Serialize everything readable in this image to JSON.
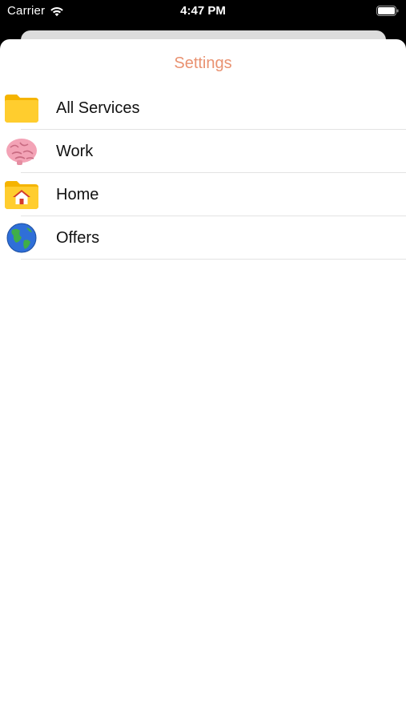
{
  "status_bar": {
    "carrier": "Carrier",
    "time": "4:47 PM",
    "wifi_icon": "wifi-icon",
    "battery_icon": "battery-icon"
  },
  "sheet": {
    "title": "Settings",
    "title_color": "#e99271"
  },
  "list": {
    "items": [
      {
        "label": "All Services",
        "icon": "folder-icon"
      },
      {
        "label": "Work",
        "icon": "brain-icon"
      },
      {
        "label": "Home",
        "icon": "house-folder-icon"
      },
      {
        "label": "Offers",
        "icon": "globe-icon"
      }
    ]
  }
}
